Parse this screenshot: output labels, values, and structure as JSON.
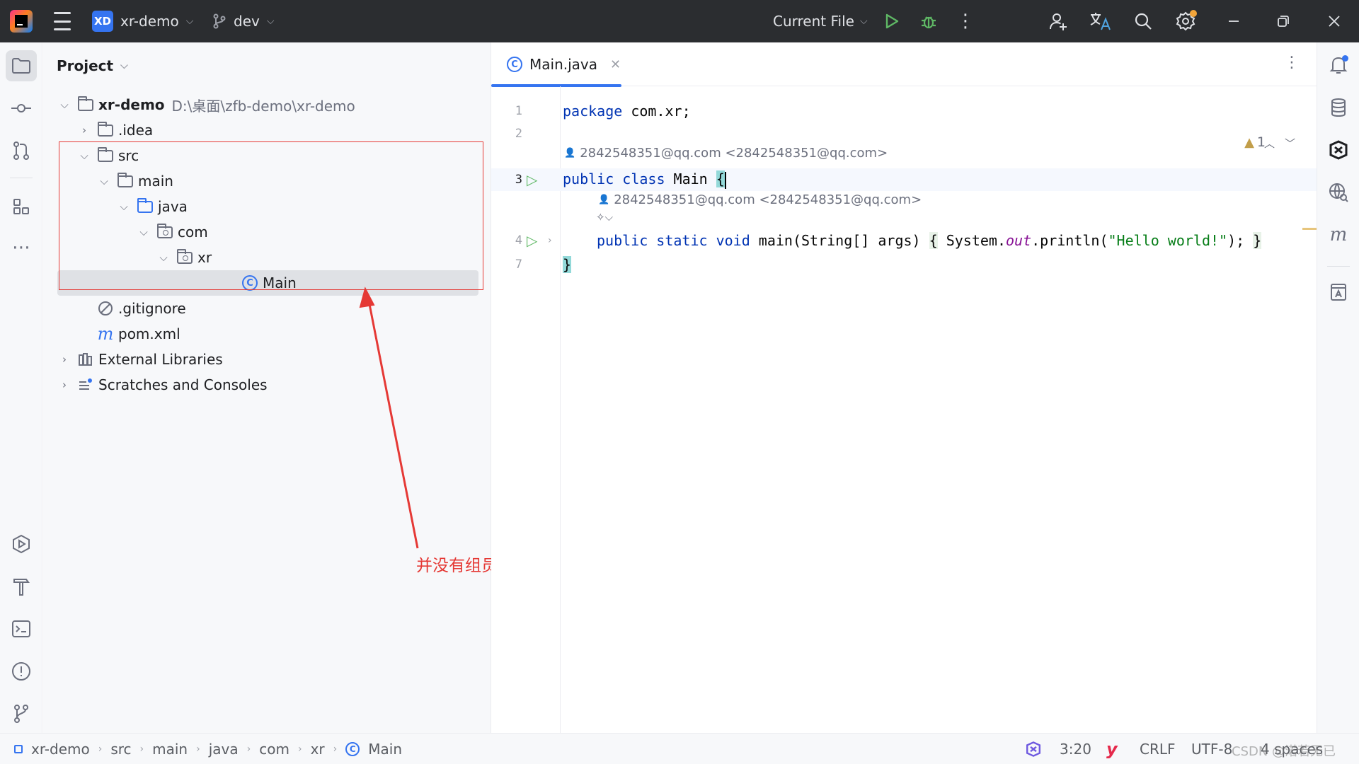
{
  "titlebar": {
    "project_badge": "XD",
    "project_name": "xr-demo",
    "branch": "dev",
    "run_config": "Current File"
  },
  "project_panel": {
    "title": "Project",
    "tree": [
      {
        "label": "xr-demo",
        "path": "D:\\桌面\\zfb-demo\\xr-demo"
      },
      {
        "label": ".idea"
      },
      {
        "label": "src"
      },
      {
        "label": "main"
      },
      {
        "label": "java"
      },
      {
        "label": "com"
      },
      {
        "label": "xr"
      },
      {
        "label": "Main"
      },
      {
        "label": ".gitignore"
      },
      {
        "label": "pom.xml"
      },
      {
        "label": "External Libraries"
      },
      {
        "label": "Scratches and Consoles"
      }
    ]
  },
  "annotation": {
    "text": "并没有组员李四提交的最新的代码"
  },
  "editor": {
    "tab_label": "Main.java",
    "warning_count": "1",
    "author_1": "2842548351@qq.com <2842548351@qq.com>",
    "author_2": "2842548351@qq.com <2842548351@qq.com>",
    "line_numbers": [
      "1",
      "2",
      "3",
      "4",
      "7"
    ],
    "code": {
      "l1_kw": "package",
      "l1_rest": " com.xr;",
      "l3_kw": "public class",
      "l3_name": " Main ",
      "l3_brace": "{",
      "l4_kw": "public static void",
      "l4_rest1": " main(String[] args) ",
      "l4_open": "{",
      "l4_rest2": " System.",
      "l4_out": "out",
      "l4_rest3": ".println(",
      "l4_str": "\"Hello world!\"",
      "l4_rest4": "); ",
      "l4_close": "}",
      "l7_brace": "}"
    }
  },
  "statusbar": {
    "crumbs": [
      "xr-demo",
      "src",
      "main",
      "java",
      "com",
      "xr",
      "Main"
    ],
    "position": "3:20",
    "line_sep": "CRLF",
    "encoding": "UTF-8",
    "indent": "4 spaces",
    "watermark": "CSDN @渃若无已"
  },
  "colors": {
    "accent": "#3574f0",
    "run_green": "#5fb865",
    "annotation_red": "#e53935",
    "titlebar_bg": "#2b2d30"
  },
  "icons": {
    "titlebar": [
      "intellij-logo-icon",
      "hamburger-menu-icon",
      "branch-icon",
      "run-icon",
      "debug-icon",
      "more-vertical-icon",
      "add-user-icon",
      "translate-icon",
      "search-icon",
      "settings-icon",
      "minimize-icon",
      "maximize-icon",
      "close-icon"
    ],
    "left_strip": [
      "folder-icon",
      "commit-icon",
      "pull-requests-icon",
      "structure-icon",
      "more-icon",
      "services-icon",
      "build-icon",
      "terminal-icon",
      "problems-icon",
      "git-icon"
    ],
    "right_strip": [
      "notifications-icon",
      "database-icon",
      "ai-assistant-icon",
      "endpoints-icon",
      "maven-icon",
      "translation-icon"
    ]
  }
}
